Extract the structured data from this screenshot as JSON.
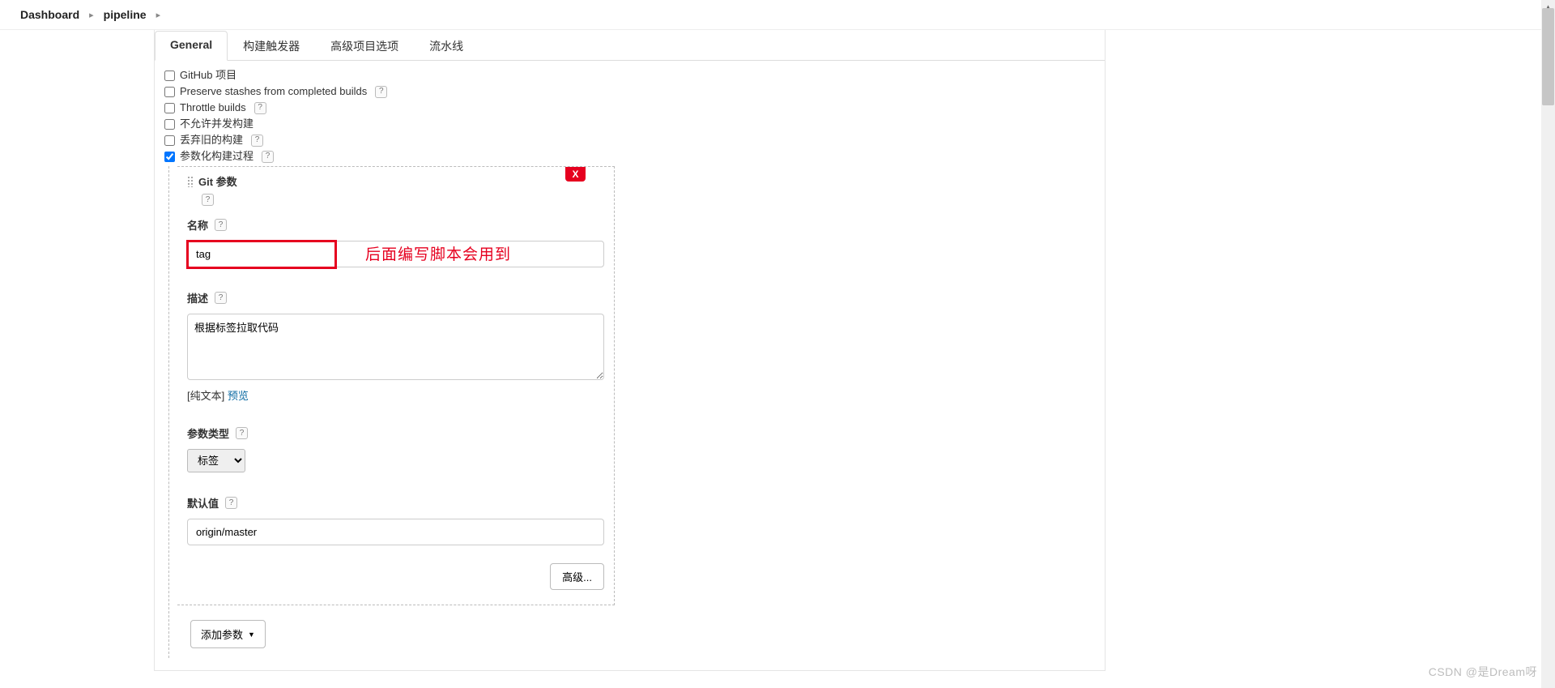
{
  "breadcrumb": {
    "items": [
      "Dashboard",
      "pipeline"
    ]
  },
  "tabs": {
    "items": [
      {
        "label": "General",
        "active": true
      },
      {
        "label": "构建触发器",
        "active": false
      },
      {
        "label": "高级项目选项",
        "active": false
      },
      {
        "label": "流水线",
        "active": false
      }
    ]
  },
  "general": {
    "checkboxes": [
      {
        "label": "GitHub 项目",
        "checked": false,
        "help": false
      },
      {
        "label": "Preserve stashes from completed builds",
        "checked": false,
        "help": true
      },
      {
        "label": "Throttle builds",
        "checked": false,
        "help": true
      },
      {
        "label": "不允许并发构建",
        "checked": false,
        "help": false
      },
      {
        "label": "丢弃旧的构建",
        "checked": false,
        "help": true
      },
      {
        "label": "参数化构建过程",
        "checked": true,
        "help": true
      }
    ]
  },
  "param": {
    "delete": "X",
    "title": "Git 参数",
    "name_label": "名称",
    "name_value": "tag",
    "annotation": "后面编写脚本会用到",
    "desc_label": "描述",
    "desc_value": "根据标签拉取代码",
    "plain_text_label": "[纯文本]",
    "preview_link": "预览",
    "type_label": "参数类型",
    "type_value": "标签",
    "default_label": "默认值",
    "default_value": "origin/master",
    "advanced_btn": "高级...",
    "add_param_btn": "添加参数"
  },
  "help_icon": "?",
  "watermark": "CSDN @是Dream呀"
}
